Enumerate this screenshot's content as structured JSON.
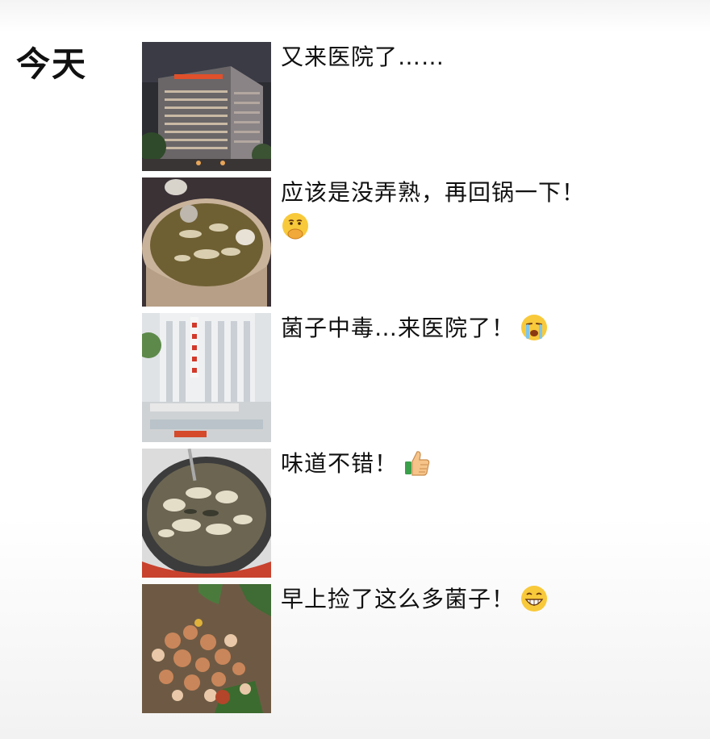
{
  "feed": {
    "date_label": "今天",
    "posts": [
      {
        "caption": "又来医院了……",
        "image": "hospital-night-photo",
        "emoji": null
      },
      {
        "caption": "应该是没弄熟，再回锅一下！",
        "image": "mushroom-pot-photo",
        "emoji": "hand-over-mouth-emoji"
      },
      {
        "caption": "菌子中毒…来医院了！",
        "image": "hospital-day-photo",
        "emoji": "crying-emoji"
      },
      {
        "caption": "味道不错！",
        "image": "mushroom-stew-photo",
        "emoji": "thumbs-up-emoji"
      },
      {
        "caption": "早上捡了这么多菌子！",
        "image": "wild-mushrooms-photo",
        "emoji": "grinning-emoji"
      }
    ]
  }
}
